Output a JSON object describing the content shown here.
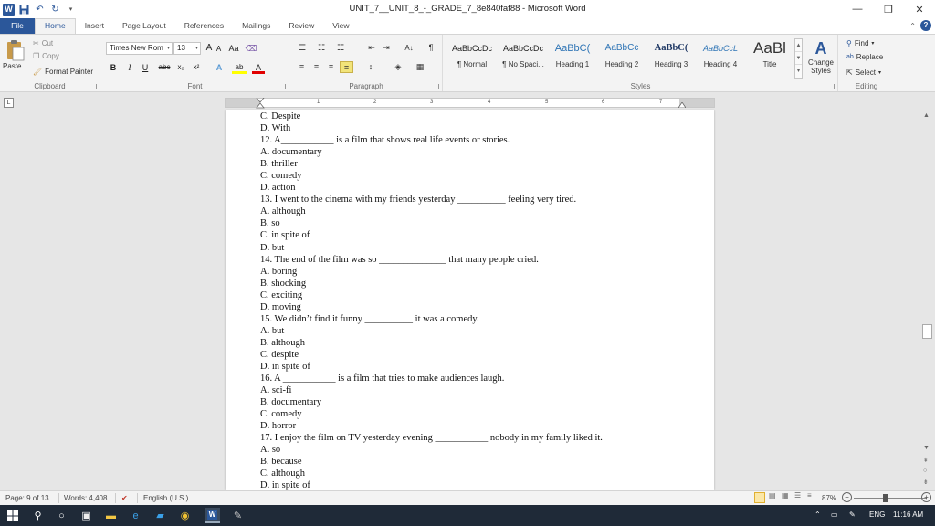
{
  "window": {
    "title": "UNIT_7__UNIT_8_-_GRADE_7_8e840faf88 - Microsoft Word",
    "minimize": "—",
    "restore": "❐",
    "close": "✕"
  },
  "qat": {
    "word_icon": "W",
    "save_icon": "💾",
    "undo_icon": "↶",
    "redo_icon": "↻",
    "custom_icon": "▾"
  },
  "tabs": [
    "File",
    "Home",
    "Insert",
    "Page Layout",
    "References",
    "Mailings",
    "Review",
    "View"
  ],
  "help": {
    "caret": "⌃",
    "question": "?"
  },
  "clipboard": {
    "paste": "Paste",
    "cut": "Cut",
    "copy": "Copy",
    "format_painter": "Format Painter",
    "label": "Clipboard"
  },
  "font": {
    "name": "Times New Rom",
    "size": "13",
    "grow": "A",
    "shrink": "A",
    "case": "Aa",
    "clear": "⌫",
    "bold": "B",
    "italic": "I",
    "underline": "U",
    "strike": "abc",
    "sub": "x₂",
    "sup": "x²",
    "effects": "A",
    "highlight": "ab",
    "color": "A",
    "label": "Font"
  },
  "paragraph": {
    "bullets": "☰",
    "numbering": "☷",
    "multilevel": "☵",
    "decrease": "⇤",
    "increase": "⇥",
    "sort": "A↓",
    "pilcrow": "¶",
    "align_left": "≡",
    "center": "≡",
    "align_right": "≡",
    "justify": "≡",
    "spacing": "↕",
    "shading": "◈",
    "borders": "▦",
    "label": "Paragraph"
  },
  "styles": {
    "items": [
      {
        "preview": "AaBbCcDc",
        "name": "¶ Normal",
        "color": "#222222"
      },
      {
        "preview": "AaBbCcDc",
        "name": "¶ No Spaci...",
        "color": "#222222"
      },
      {
        "preview": "AaBbC(",
        "name": "Heading 1",
        "color": "#2e74b5"
      },
      {
        "preview": "AaBbCc",
        "name": "Heading 2",
        "color": "#2e74b5"
      },
      {
        "preview": "AaBbC(",
        "name": "Heading 3",
        "color": "#1f3864"
      },
      {
        "preview": "AaBbCcL",
        "name": "Heading 4",
        "color": "#2e74b5"
      },
      {
        "preview": "AaBl",
        "name": "Title",
        "color": "#333333"
      }
    ],
    "change_styles": "Change Styles",
    "label": "Styles"
  },
  "editing": {
    "find": "Find",
    "replace": "Replace",
    "select": "Select",
    "label": "Editing"
  },
  "ruler": {
    "corner": "L",
    "ticks": [
      "1",
      "2",
      "3",
      "4",
      "5",
      "6",
      "7"
    ]
  },
  "document": {
    "lines": [
      "C. Despite",
      "D. With",
      "12. A___________ is a film that shows real life events or stories.",
      "A. documentary",
      "B. thriller",
      "C. comedy",
      "D. action",
      "13. I went to the cinema with my friends yesterday __________ feeling very tired.",
      "A. although",
      "B. so",
      "C. in spite of",
      "D. but",
      "14. The end of the film was so ______________ that many people cried.",
      "A. boring",
      "B. shocking",
      "C. exciting",
      "D. moving",
      "15. We didn’t find it funny __________ it was a comedy.",
      "A. but",
      "B. although",
      "C. despite",
      "D. in spite of",
      "16. A ___________ is a film that tries to make audiences laugh.",
      "A. sci-fi",
      "B. documentary",
      "C. comedy",
      "D. horror",
      "17. I enjoy the film on TV yesterday evening ___________ nobody in my family liked it.",
      "A. so",
      "B. because",
      "C. although",
      "D. in spite of"
    ]
  },
  "statusbar": {
    "page": "Page: 9 of 13",
    "words": "Words: 4,408",
    "language": "English (U.S.)",
    "zoom": "87%",
    "zoom_level": 0.87
  },
  "taskbar": {
    "lang": "ENG",
    "time": "11:16 AM"
  }
}
